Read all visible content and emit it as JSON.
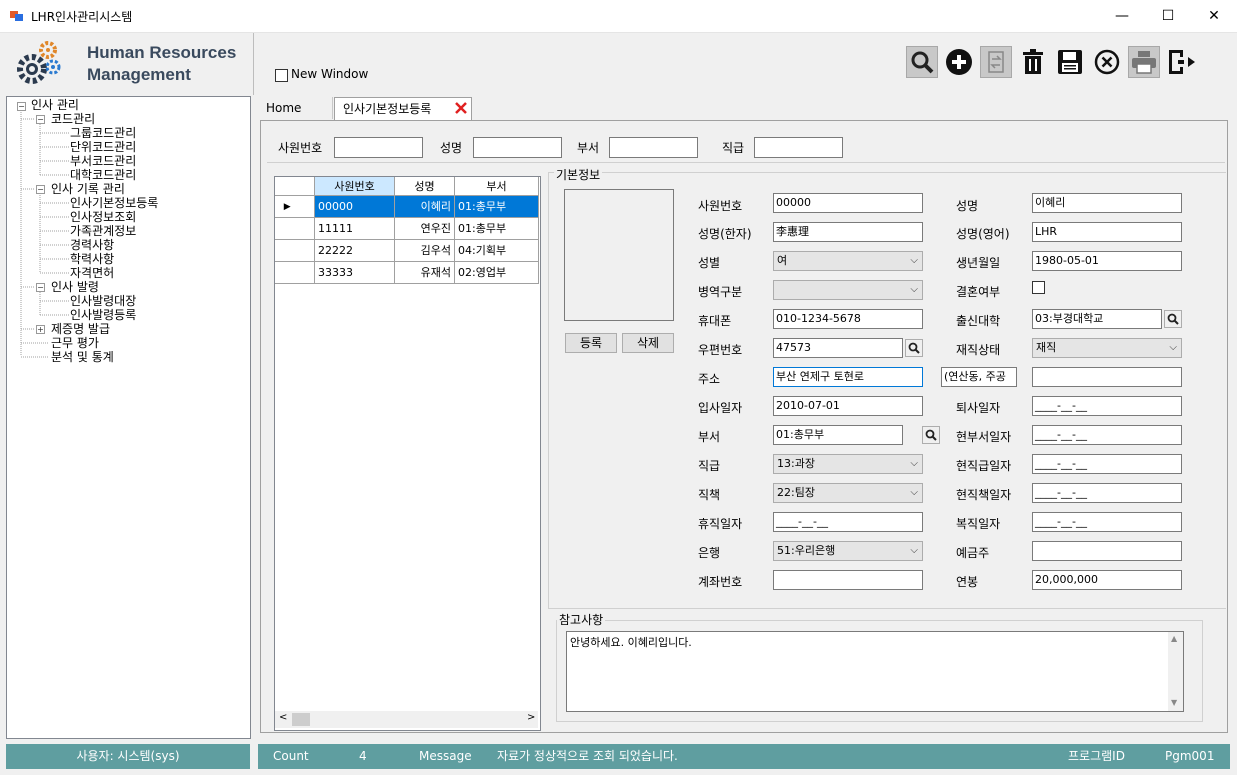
{
  "window": {
    "title": "LHR인사관리시스템",
    "minimize": "—",
    "maximize": "☐",
    "close": "✕"
  },
  "logo": {
    "line1": "Human Resources",
    "line2": "Management"
  },
  "new_window_label": "New Window",
  "toolbar": [
    "search-icon",
    "add-icon",
    "swap-icon",
    "delete-icon",
    "save-icon",
    "cancel-icon",
    "print-icon",
    "exit-icon"
  ],
  "tree": {
    "root": "인사 관리",
    "code": "코드관리",
    "code_items": [
      "그룹코드관리",
      "단위코드관리",
      "부서코드관리",
      "대학코드관리"
    ],
    "record": "인사 기록 관리",
    "record_items": [
      "인사기본정보등록",
      "인사정보조회",
      "가족관계정보",
      "경력사항",
      "학력사항",
      "자격면허"
    ],
    "order": "인사 발령",
    "order_items": [
      "인사발령대장",
      "인사발령등록"
    ],
    "cert": "제증명 발급",
    "eval": "근무 평가",
    "stats": "분석 및 통계"
  },
  "tabs": {
    "home": "Home",
    "active": "인사기본정보등록"
  },
  "search": {
    "emp_no": "사원번호",
    "name": "성명",
    "dept": "부서",
    "rank": "직급"
  },
  "grid": {
    "headers": [
      "사원번호",
      "성명",
      "부서"
    ],
    "rows": [
      {
        "no": "00000",
        "name": "이혜리",
        "dept": "01:총무부"
      },
      {
        "no": "11111",
        "name": "연우진",
        "dept": "01:총무부"
      },
      {
        "no": "22222",
        "name": "김우석",
        "dept": "04:기획부"
      },
      {
        "no": "33333",
        "name": "유재석",
        "dept": "02:영업부"
      }
    ]
  },
  "basic": {
    "group": "기본정보",
    "register": "등록",
    "delete": "삭제",
    "labels": {
      "emp_no": "사원번호",
      "name_hanja": "성명(한자)",
      "gender": "성별",
      "military": "병역구분",
      "mobile": "휴대폰",
      "zip": "우편번호",
      "addr": "주소",
      "hire": "입사일자",
      "dept": "부서",
      "rank": "직급",
      "position": "직책",
      "leave": "휴직일자",
      "bank": "은행",
      "account": "계좌번호",
      "name": "성명",
      "name_en": "성명(영어)",
      "birth": "생년월일",
      "married": "결혼여부",
      "univ": "출신대학",
      "status": "재직상태",
      "retire": "퇴사일자",
      "dept_date": "현부서일자",
      "rank_date": "현직급일자",
      "pos_date": "현직책일자",
      "reinstate": "복직일자",
      "holder": "예금주",
      "salary": "연봉"
    },
    "values": {
      "emp_no": "00000",
      "name_hanja": "李惠理",
      "gender": "여",
      "military": "",
      "mobile": "010-1234-5678",
      "zip": "47573",
      "addr": "부산 연제구 토현로",
      "addr2": "(연산동, 주공",
      "addr3": "",
      "hire": "2010-07-01",
      "dept": "01:총무부",
      "rank": "13:과장",
      "position": "22:팀장",
      "leave": "____-__-__",
      "bank": "51:우리은행",
      "account": "",
      "name": "이혜리",
      "name_en": "LHR",
      "birth": "1980-05-01",
      "univ": "03:부경대학교",
      "status": "재직",
      "retire": "____-__-__",
      "dept_date": "____-__-__",
      "rank_date": "____-__-__",
      "pos_date": "____-__-__",
      "reinstate": "____-__-__",
      "holder": "",
      "salary": "20,000,000"
    }
  },
  "notes": {
    "label": "참고사항",
    "text": "안녕하세요. 이혜리입니다."
  },
  "statusbar": {
    "user": "사용자: 시스템(sys)",
    "count_label": "Count",
    "count": "4",
    "message_label": "Message",
    "message": "자료가 정상적으로 조회 되었습니다.",
    "program_label": "프로그램ID",
    "program": "Pgm001"
  }
}
